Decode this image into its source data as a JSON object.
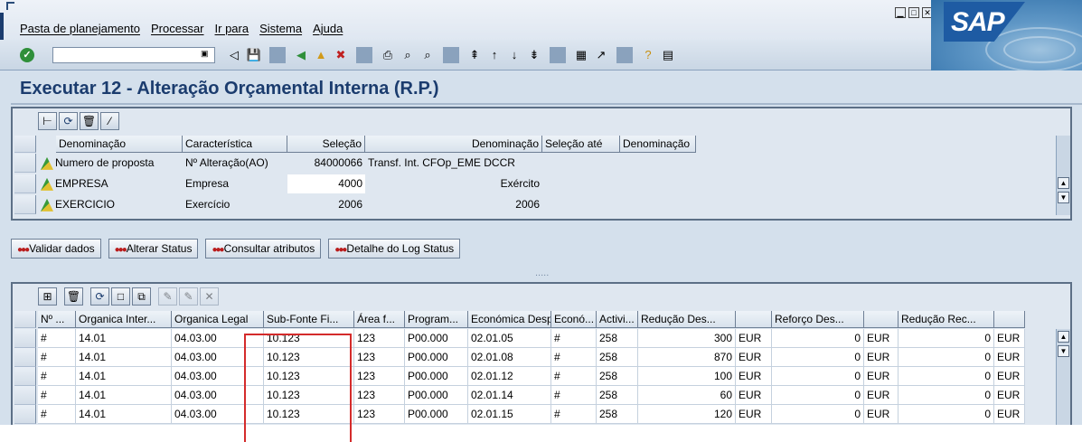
{
  "menu": [
    "Pasta de planejamento",
    "Processar",
    "Ir para",
    "Sistema",
    "Ajuda"
  ],
  "logo_text": "SAP",
  "window_buttons": [
    "minimize",
    "maximize",
    "close"
  ],
  "command_field": {
    "value": ""
  },
  "page_title": "Executar 12 - Alteração Orçamental Interna (R.P.)",
  "upper_grid": {
    "headers": [
      "Denominação",
      "Característica",
      "Seleção",
      "Denominação",
      "Seleção até",
      "Denominação"
    ],
    "rows": [
      {
        "denominacao": "Numero de proposta",
        "caracteristica": "Nº Alteração(AO)",
        "selecao": "84000066",
        "denominacao2": "Transf. Int. CFOp_EME DCCR",
        "selecao_ate": "",
        "denominacao3": ""
      },
      {
        "denominacao": "EMPRESA",
        "caracteristica": "Empresa",
        "selecao": "4000",
        "denominacao2": "Exército",
        "selecao_ate": "",
        "denominacao3": ""
      },
      {
        "denominacao": "EXERCICIO",
        "caracteristica": "Exercício",
        "selecao": "2006",
        "denominacao2": "2006",
        "selecao_ate": "",
        "denominacao3": ""
      }
    ]
  },
  "action_buttons": [
    "Validar dados",
    "Alterar Status",
    "Consultar atributos",
    "Detalhe do Log Status"
  ],
  "splitter_dots": ".....",
  "lower_grid": {
    "headers": [
      "Nº ...",
      "Organica Inter...",
      "Organica Legal",
      "Sub-Fonte Fi...",
      "Área f...",
      "Program...",
      "Económica Desp.",
      "Econó...",
      "Activi...",
      "Redução Des...",
      "",
      "Reforço Des...",
      "",
      "Redução Rec...",
      ""
    ],
    "rows": [
      [
        "#",
        "14.01",
        "04.03.00",
        "10.123",
        "123",
        "P00.000",
        "02.01.05",
        "#",
        "258",
        "300",
        "EUR",
        "0",
        "EUR",
        "0",
        "EUR"
      ],
      [
        "#",
        "14.01",
        "04.03.00",
        "10.123",
        "123",
        "P00.000",
        "02.01.08",
        "#",
        "258",
        "870",
        "EUR",
        "0",
        "EUR",
        "0",
        "EUR"
      ],
      [
        "#",
        "14.01",
        "04.03.00",
        "10.123",
        "123",
        "P00.000",
        "02.01.12",
        "#",
        "258",
        "100",
        "EUR",
        "0",
        "EUR",
        "0",
        "EUR"
      ],
      [
        "#",
        "14.01",
        "04.03.00",
        "10.123",
        "123",
        "P00.000",
        "02.01.14",
        "#",
        "258",
        "60",
        "EUR",
        "0",
        "EUR",
        "0",
        "EUR"
      ],
      [
        "#",
        "14.01",
        "04.03.00",
        "10.123",
        "123",
        "P00.000",
        "02.01.15",
        "#",
        "258",
        "120",
        "EUR",
        "0",
        "EUR",
        "0",
        "EUR"
      ]
    ]
  },
  "colors": {
    "title": "#1b3c6e",
    "highlight": "#d42b2b",
    "panel": "#dfe7f0"
  }
}
